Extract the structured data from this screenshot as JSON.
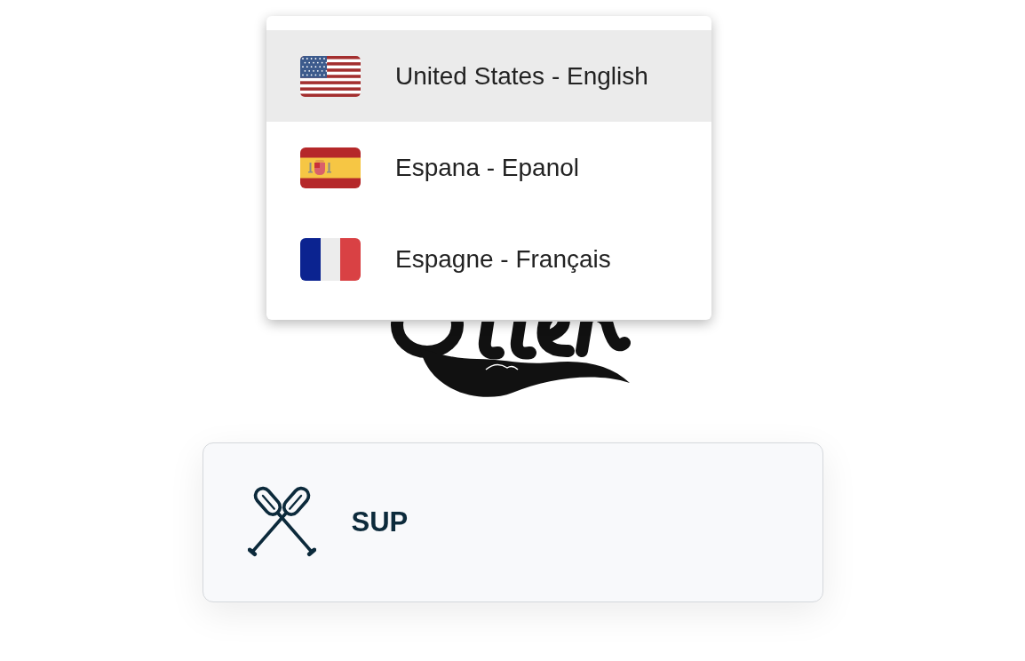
{
  "language_menu": {
    "options": [
      {
        "label": "United States - English",
        "selected": true
      },
      {
        "label": "Espana - Epanol",
        "selected": false
      },
      {
        "label": "Espagne - Français",
        "selected": false
      }
    ]
  },
  "category_card": {
    "label": "SUP"
  }
}
